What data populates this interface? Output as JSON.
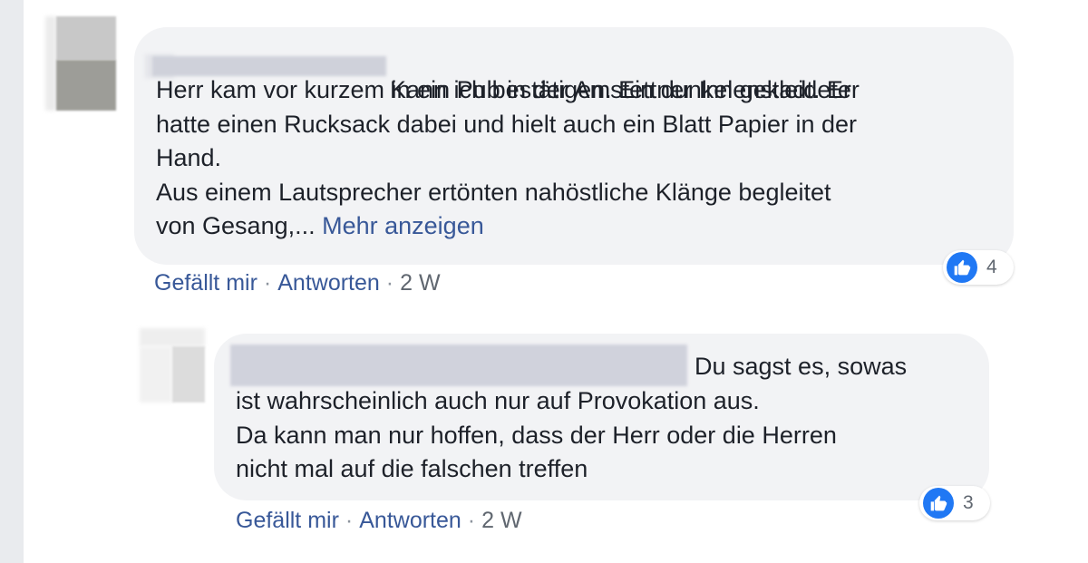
{
  "comment": {
    "first_line": "Kann ich bestätigen. Ein dunkel gekleideter",
    "body": "Herr kam vor kurzem in ein Pub in der Amstettner Innenstadt. Er\nhatte einen Rucksack dabei und hielt auch ein Blatt Papier in der\nHand.\nAus einem Lautsprecher ertönten nahöstliche Klänge begleitet\nvon Gesang,... ",
    "see_more": "Mehr anzeigen",
    "reaction_count": "4",
    "like_label": "Gefällt mir",
    "reply_label": "Antworten",
    "age": "2 W"
  },
  "reply": {
    "first_line": "Du sagst es, sowas",
    "body": "ist wahrscheinlich auch nur auf Provokation aus.\nDa kann man nur hoffen, dass der Herr oder die Herren\nnicht mal auf die falschen treffen",
    "reaction_count": "3",
    "like_label": "Gefällt mir",
    "reply_label": "Antworten",
    "age": "2 W"
  },
  "icons": {
    "reaction": "thumbs-up-icon",
    "reaction_color": "#2078f4",
    "link_color": "#385898"
  },
  "separator": "·"
}
